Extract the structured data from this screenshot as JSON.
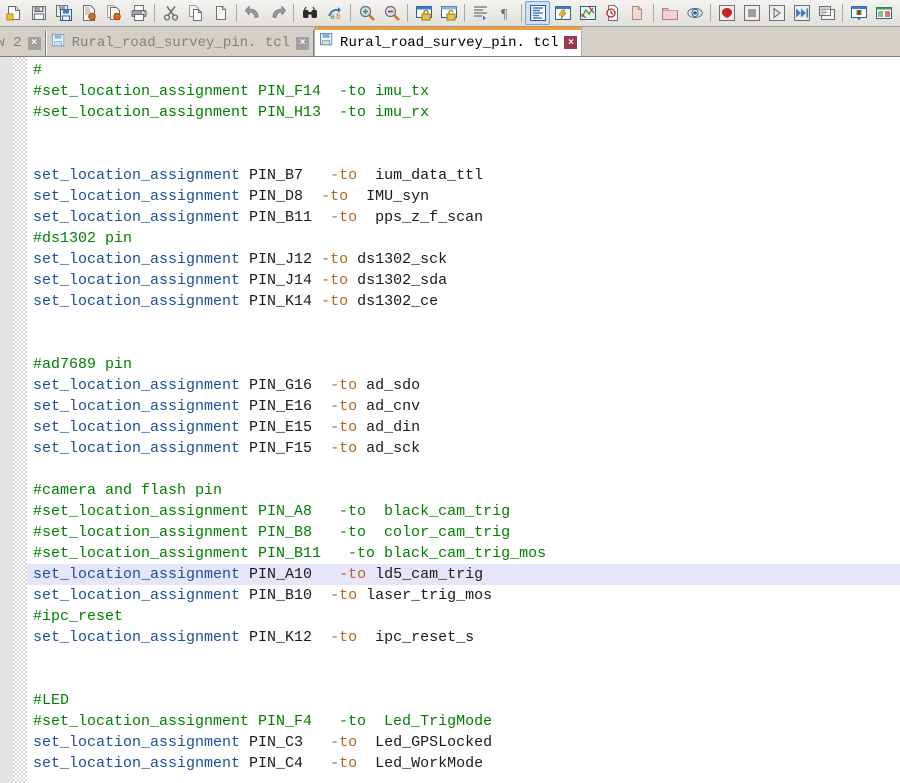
{
  "toolbar": {
    "items": [
      {
        "name": "new-file-icon",
        "title": "New"
      },
      {
        "name": "save-icon",
        "title": "Save"
      },
      {
        "name": "save-all-icon",
        "title": "Save All"
      },
      {
        "name": "open-page-icon",
        "title": "Open"
      },
      {
        "name": "open-all-pages-icon",
        "title": "Open All"
      },
      {
        "name": "print-icon",
        "title": "Print"
      },
      {
        "name": "separator",
        "title": ""
      },
      {
        "name": "cut-icon",
        "title": "Cut"
      },
      {
        "name": "copy-icon",
        "title": "Copy"
      },
      {
        "name": "paste-icon",
        "title": "Paste"
      },
      {
        "name": "separator",
        "title": ""
      },
      {
        "name": "undo-icon",
        "title": "Undo"
      },
      {
        "name": "redo-icon",
        "title": "Redo"
      },
      {
        "name": "separator",
        "title": ""
      },
      {
        "name": "find-icon",
        "title": "Find"
      },
      {
        "name": "find-replace-icon",
        "title": "Replace"
      },
      {
        "name": "separator",
        "title": ""
      },
      {
        "name": "zoom-in-icon",
        "title": "Zoom In"
      },
      {
        "name": "zoom-out-icon",
        "title": "Zoom Out"
      },
      {
        "name": "separator",
        "title": ""
      },
      {
        "name": "lock-pane-icon",
        "title": "Lock"
      },
      {
        "name": "unlock-pane-icon",
        "title": "Unlock"
      },
      {
        "name": "separator",
        "title": ""
      },
      {
        "name": "indent-icon",
        "title": "Indent"
      },
      {
        "name": "paragraph-marks-icon",
        "title": "Show Marks"
      },
      {
        "name": "separator",
        "title": ""
      },
      {
        "name": "outline-view-icon",
        "title": "Outline",
        "pressed": true
      },
      {
        "name": "compile-design-icon",
        "title": "Compile"
      },
      {
        "name": "chip-planner-icon",
        "title": "Chip Planner"
      },
      {
        "name": "timing-analyzer-icon",
        "title": "Timing Analyzer"
      },
      {
        "name": "report-icon",
        "title": "Report"
      },
      {
        "name": "separator",
        "title": ""
      },
      {
        "name": "folder-icon",
        "title": "Project Navigator"
      },
      {
        "name": "rtl-viewer-icon",
        "title": "RTL Viewer"
      },
      {
        "name": "separator",
        "title": ""
      },
      {
        "name": "record-icon",
        "title": "Record"
      },
      {
        "name": "stop-icon",
        "title": "Stop"
      },
      {
        "name": "play-icon",
        "title": "Run"
      },
      {
        "name": "fast-forward-icon",
        "title": "Run Fast"
      },
      {
        "name": "calculator-icon",
        "title": "Tools"
      },
      {
        "name": "separator",
        "title": ""
      },
      {
        "name": "pin-planner-icon",
        "title": "Pin Planner"
      },
      {
        "name": "assignment-editor-icon",
        "title": "Assignment Editor"
      }
    ]
  },
  "tabbar": {
    "tabs": [
      {
        "label": "ew 2",
        "active": false,
        "clipped": true,
        "show_icon": false,
        "close_label": "×"
      },
      {
        "label": "Rural_road_survey_pin. tcl",
        "active": false,
        "clipped": false,
        "show_icon": true,
        "close_label": "×"
      },
      {
        "label": "Rural_road_survey_pin. tcl",
        "active": true,
        "clipped": false,
        "show_icon": true,
        "close_label": "×"
      }
    ]
  },
  "editor": {
    "highlight_color": "#e6e6fa",
    "comment_color": "#008000",
    "keyword_color": "#1a4fa0",
    "operator_color": "#b5651d",
    "lines": [
      {
        "type": "comment",
        "text": "#"
      },
      {
        "type": "comment",
        "text": "#set_location_assignment PIN_F14  -to imu_tx"
      },
      {
        "type": "comment",
        "text": "#set_location_assignment PIN_H13  -to imu_rx"
      },
      {
        "type": "blank",
        "text": ""
      },
      {
        "type": "blank",
        "text": ""
      },
      {
        "type": "code",
        "kw": "set_location_assignment",
        "pin": " PIN_B7   ",
        "op": "-to ",
        "sig": " ium_data_ttl"
      },
      {
        "type": "code",
        "kw": "set_location_assignment",
        "pin": " PIN_D8  ",
        "op": "-to ",
        "sig": " IMU_syn"
      },
      {
        "type": "code",
        "kw": "set_location_assignment",
        "pin": " PIN_B11  ",
        "op": "-to ",
        "sig": " pps_z_f_scan"
      },
      {
        "type": "comment",
        "text": "#ds1302 pin"
      },
      {
        "type": "code",
        "kw": "set_location_assignment",
        "pin": " PIN_J12 ",
        "op": "-to ",
        "sig": "ds1302_sck"
      },
      {
        "type": "code",
        "kw": "set_location_assignment",
        "pin": " PIN_J14 ",
        "op": "-to ",
        "sig": "ds1302_sda"
      },
      {
        "type": "code",
        "kw": "set_location_assignment",
        "pin": " PIN_K14 ",
        "op": "-to ",
        "sig": "ds1302_ce"
      },
      {
        "type": "blank",
        "text": ""
      },
      {
        "type": "blank",
        "text": ""
      },
      {
        "type": "comment",
        "text": "#ad7689 pin"
      },
      {
        "type": "code",
        "kw": "set_location_assignment",
        "pin": " PIN_G16 ",
        "op": " -to ",
        "sig": "ad_sdo"
      },
      {
        "type": "code",
        "kw": "set_location_assignment",
        "pin": " PIN_E16 ",
        "op": " -to ",
        "sig": "ad_cnv"
      },
      {
        "type": "code",
        "kw": "set_location_assignment",
        "pin": " PIN_E15 ",
        "op": " -to ",
        "sig": "ad_din"
      },
      {
        "type": "code",
        "kw": "set_location_assignment",
        "pin": " PIN_F15 ",
        "op": " -to ",
        "sig": "ad_sck"
      },
      {
        "type": "blank",
        "text": ""
      },
      {
        "type": "comment",
        "text": "#camera and flash pin"
      },
      {
        "type": "comment",
        "text": "#set_location_assignment PIN_A8   -to  black_cam_trig"
      },
      {
        "type": "comment",
        "text": "#set_location_assignment PIN_B8   -to  color_cam_trig"
      },
      {
        "type": "comment",
        "text": "#set_location_assignment PIN_B11   -to black_cam_trig_mos"
      },
      {
        "type": "code",
        "highlight": true,
        "kw": "set_location_assignment",
        "pin": " PIN_A10  ",
        "op": " -to ",
        "sig": "ld5_cam_trig"
      },
      {
        "type": "code",
        "kw": "set_location_assignment",
        "pin": " PIN_B10  ",
        "op": "-to ",
        "sig": "laser_trig_mos"
      },
      {
        "type": "comment",
        "text": "#ipc_reset"
      },
      {
        "type": "code",
        "kw": "set_location_assignment",
        "pin": " PIN_K12  ",
        "op": "-to ",
        "sig": " ipc_reset_s"
      },
      {
        "type": "blank",
        "text": ""
      },
      {
        "type": "blank",
        "text": ""
      },
      {
        "type": "comment",
        "text": "#LED"
      },
      {
        "type": "comment",
        "text": "#set_location_assignment PIN_F4   -to  Led_TrigMode"
      },
      {
        "type": "code",
        "kw": "set_location_assignment",
        "pin": " PIN_C3  ",
        "op": " -to ",
        "sig": " Led_GPSLocked"
      },
      {
        "type": "code",
        "kw": "set_location_assignment",
        "pin": " PIN_C4  ",
        "op": " -to ",
        "sig": " Led_WorkMode"
      }
    ]
  }
}
